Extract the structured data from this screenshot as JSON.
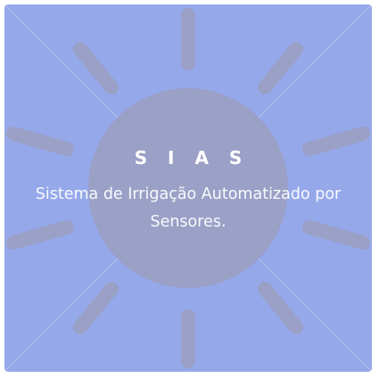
{
  "card": {
    "title": "S I A S",
    "subtitle": "Sistema de Irrigação Automatizado por Sensores.",
    "icon": "sun-icon"
  },
  "colors": {
    "background": "#95a8ea",
    "sun": "#9aa0c6",
    "text": "#ffffff"
  }
}
